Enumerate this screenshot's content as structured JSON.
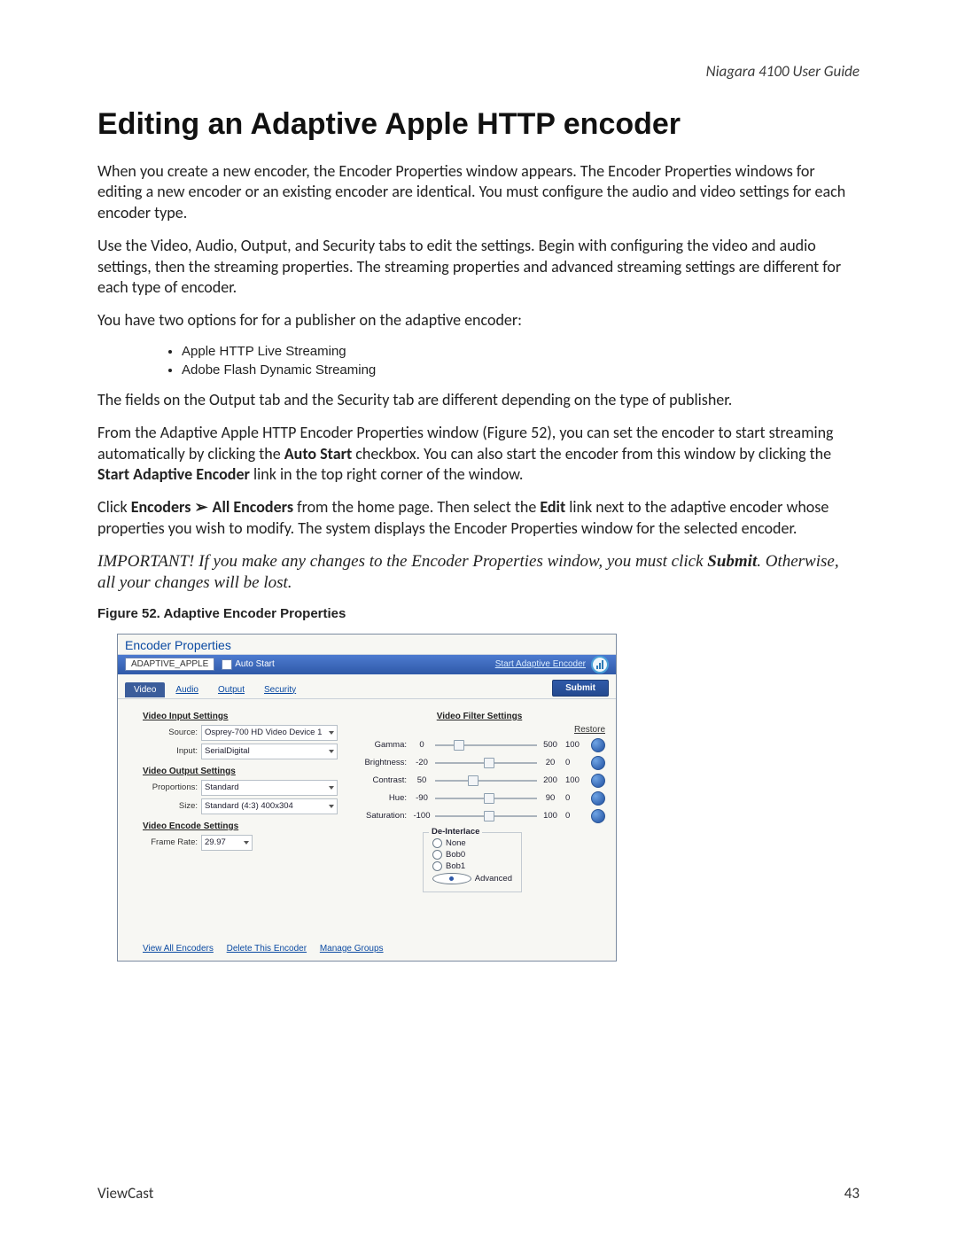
{
  "header": {
    "running_title": "Niagara 4100 User Guide"
  },
  "title": "Editing an Adaptive Apple HTTP encoder",
  "paras": {
    "p1": "When you create a new encoder, the Encoder Properties window appears. The Encoder Properties windows for editing a new encoder or an existing encoder are identical. You must configure the audio and video settings for each encoder type.",
    "p2": "Use the Video, Audio, Output, and Security tabs to edit the settings. Begin with configuring the video and audio settings, then the streaming properties. The streaming properties and advanced streaming settings are different for each type of encoder.",
    "p3": "You have two options for for a publisher on the adaptive encoder:",
    "p4": "The fields on the Output tab and the Security tab are different depending on the type of publisher.",
    "p5a": "From the Adaptive Apple HTTP Encoder Properties window (Figure 52), you can set the encoder to start streaming automatically by clicking the ",
    "p5b": "Auto Start",
    "p5c": " checkbox. You can also start the encoder from this window by clicking the ",
    "p5d": "Start Adaptive Encoder",
    "p5e": " link in the top right corner of the window.",
    "p6a": "Click ",
    "p6b": "Encoders",
    "p6c": "All Encoders",
    "p6d": " from the home page. Then select the ",
    "p6e": "Edit",
    "p6f": " link next to the adaptive encoder whose properties you wish to modify. The system displays the Encoder Properties window for the selected encoder.",
    "importantA": "IMPORTANT! If you make any changes to the Encoder Properties window, you must click ",
    "importantB": "Submit",
    "importantC": ". Otherwise, all your changes will be lost."
  },
  "bullets": [
    "Apple HTTP Live Streaming",
    "Adobe Flash Dynamic Streaming"
  ],
  "figure_caption": "Figure 52. Adaptive Encoder Properties",
  "shot": {
    "window_title": "Encoder Properties",
    "encoder_name": "ADAPTIVE_APPLE",
    "auto_start_label": "Auto Start",
    "start_link": "Start Adaptive Encoder",
    "tabs": {
      "video": "Video",
      "audio": "Audio",
      "output": "Output",
      "security": "Security"
    },
    "submit": "Submit",
    "left": {
      "vis_head": "Video Input Settings",
      "source_label": "Source:",
      "source_value": "Osprey-700 HD Video Device 1",
      "input_label": "Input:",
      "input_value": "SerialDigital",
      "vos_head": "Video Output Settings",
      "prop_label": "Proportions:",
      "prop_value": "Standard",
      "size_label": "Size:",
      "size_value": "Standard (4:3) 400x304",
      "ves_head": "Video Encode Settings",
      "fr_label": "Frame Rate:",
      "fr_value": "29.97"
    },
    "right": {
      "vfs_head": "Video Filter Settings",
      "restore": "Restore",
      "rows": [
        {
          "label": "Gamma:",
          "min": "0",
          "max": "500",
          "val": "100"
        },
        {
          "label": "Brightness:",
          "min": "-20",
          "max": "20",
          "val": "0"
        },
        {
          "label": "Contrast:",
          "min": "50",
          "max": "200",
          "val": "100"
        },
        {
          "label": "Hue:",
          "min": "-90",
          "max": "90",
          "val": "0"
        },
        {
          "label": "Saturation:",
          "min": "-100",
          "max": "100",
          "val": "0"
        }
      ],
      "deint_legend": "De-Interlace",
      "deint_opts": [
        "None",
        "Bob0",
        "Bob1",
        "Advanced"
      ],
      "deint_selected": 3
    },
    "footer_links": [
      "View All Encoders",
      "Delete This Encoder",
      "Manage Groups"
    ]
  },
  "footer": {
    "brand": "ViewCast",
    "page": "43"
  }
}
